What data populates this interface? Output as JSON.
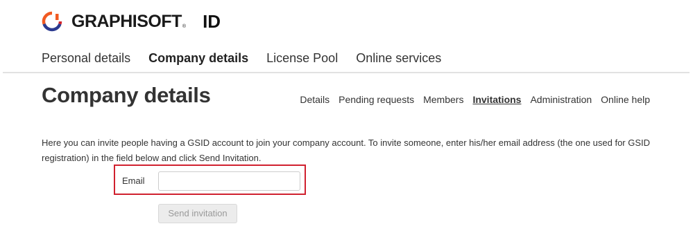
{
  "header": {
    "brand_name": "GRAPHISOFT",
    "trademark": "®",
    "id_label": "ID",
    "logo_icon": "graphisoft-logo-icon",
    "logo_colors": {
      "orange": "#f15a22",
      "blue": "#2b3a8f",
      "red": "#d2232a"
    }
  },
  "main_nav": {
    "items": [
      {
        "label": "Personal details",
        "active": false
      },
      {
        "label": "Company details",
        "active": true
      },
      {
        "label": "License Pool",
        "active": false
      },
      {
        "label": "Online services",
        "active": false
      }
    ]
  },
  "page": {
    "title": "Company details"
  },
  "sub_nav": {
    "items": [
      {
        "label": "Details",
        "active": false
      },
      {
        "label": "Pending requests",
        "active": false
      },
      {
        "label": "Members",
        "active": false
      },
      {
        "label": "Invitations",
        "active": true
      },
      {
        "label": "Administration",
        "active": false
      },
      {
        "label": "Online help",
        "active": false
      }
    ]
  },
  "invitation_form": {
    "description": "Here you can invite people having a GSID account to join your company account. To invite someone, enter his/her email address (the one used for GSID registration) in the field below and click Send Invitation.",
    "email_label": "Email",
    "email_value": "",
    "email_placeholder": "",
    "send_button_label": "Send invitation",
    "send_button_disabled": true,
    "highlight_color": "#d0202e"
  }
}
